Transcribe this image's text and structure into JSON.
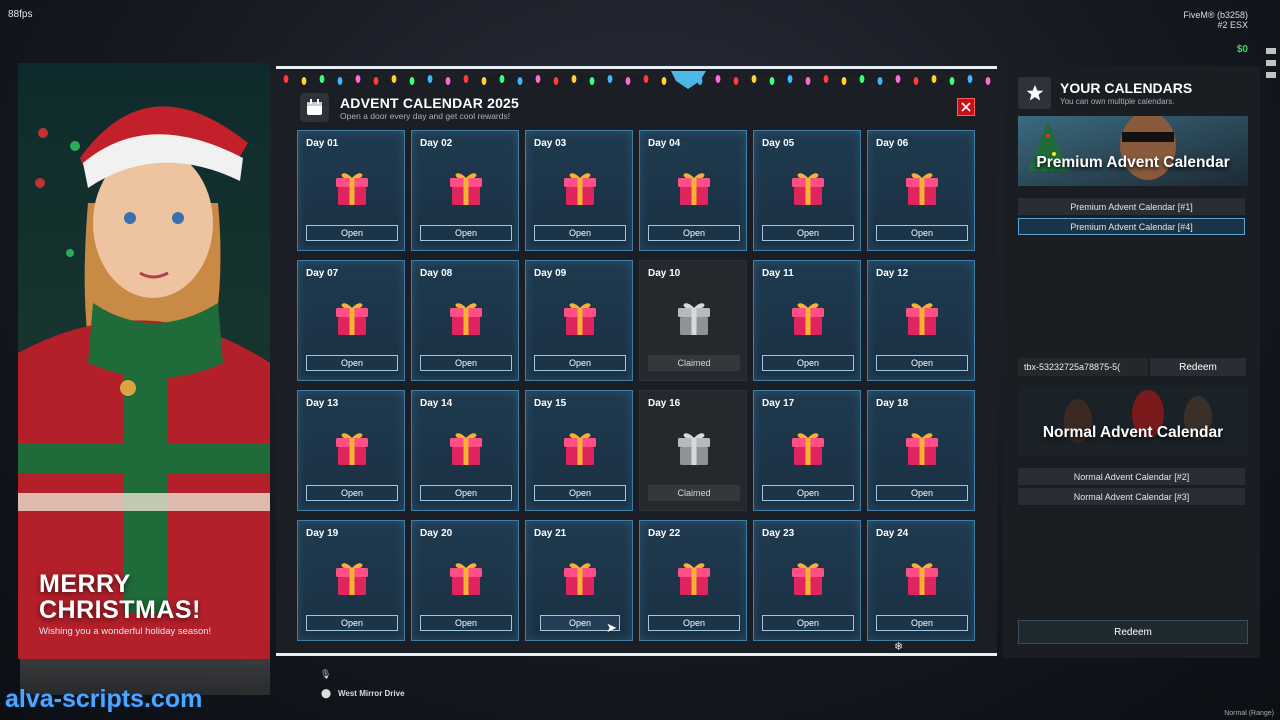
{
  "hud": {
    "fps": "88fps",
    "server": "FiveM® (b3258)",
    "rank": "#2",
    "framework": "ESX",
    "money": "$0",
    "bottom_right": "Normal (Range)"
  },
  "poster": {
    "title_line1": "MERRY",
    "title_line2": "CHRISTMAS!",
    "subtitle": "Wishing you a wonderful holiday season!"
  },
  "calendar": {
    "title": "ADVENT CALENDAR 2025",
    "subtitle": "Open a door every day and get cool rewards!",
    "days": [
      {
        "label": "Day 01",
        "button": "Open",
        "claimed": false
      },
      {
        "label": "Day 02",
        "button": "Open",
        "claimed": false
      },
      {
        "label": "Day 03",
        "button": "Open",
        "claimed": false
      },
      {
        "label": "Day 04",
        "button": "Open",
        "claimed": false
      },
      {
        "label": "Day 05",
        "button": "Open",
        "claimed": false
      },
      {
        "label": "Day 06",
        "button": "Open",
        "claimed": false
      },
      {
        "label": "Day 07",
        "button": "Open",
        "claimed": false
      },
      {
        "label": "Day 08",
        "button": "Open",
        "claimed": false
      },
      {
        "label": "Day 09",
        "button": "Open",
        "claimed": false
      },
      {
        "label": "Day 10",
        "button": "Claimed",
        "claimed": true
      },
      {
        "label": "Day 11",
        "button": "Open",
        "claimed": false
      },
      {
        "label": "Day 12",
        "button": "Open",
        "claimed": false
      },
      {
        "label": "Day 13",
        "button": "Open",
        "claimed": false
      },
      {
        "label": "Day 14",
        "button": "Open",
        "claimed": false
      },
      {
        "label": "Day 15",
        "button": "Open",
        "claimed": false
      },
      {
        "label": "Day 16",
        "button": "Claimed",
        "claimed": true
      },
      {
        "label": "Day 17",
        "button": "Open",
        "claimed": false
      },
      {
        "label": "Day 18",
        "button": "Open",
        "claimed": false
      },
      {
        "label": "Day 19",
        "button": "Open",
        "claimed": false
      },
      {
        "label": "Day 20",
        "button": "Open",
        "claimed": false
      },
      {
        "label": "Day 21",
        "button": "Open",
        "claimed": false,
        "hover": true
      },
      {
        "label": "Day 22",
        "button": "Open",
        "claimed": false
      },
      {
        "label": "Day 23",
        "button": "Open",
        "claimed": false
      },
      {
        "label": "Day 24",
        "button": "Open",
        "claimed": false
      }
    ]
  },
  "sidebar": {
    "title": "YOUR CALENDARS",
    "subtitle": "You can own multiple calendars.",
    "premium_title": "Premium Advent Calendar",
    "premium_items": [
      "Premium Advent Calendar [#1]",
      "Premium Advent Calendar [#4]"
    ],
    "code_value": "tbx-53232725a78875-5(",
    "redeem_small": "Redeem",
    "normal_title": "Normal Advent Calendar",
    "normal_items": [
      "Normal Advent Calendar [#2]",
      "Normal Advent Calendar [#3]"
    ],
    "redeem_big": "Redeem"
  },
  "footer": {
    "site": "alva-scripts.com",
    "street": "West Mirror Drive"
  },
  "colors": {
    "accent": "#3f7ea5",
    "close": "#c4121a",
    "gift": "#e0245e",
    "ribbon": "#f2b233"
  }
}
